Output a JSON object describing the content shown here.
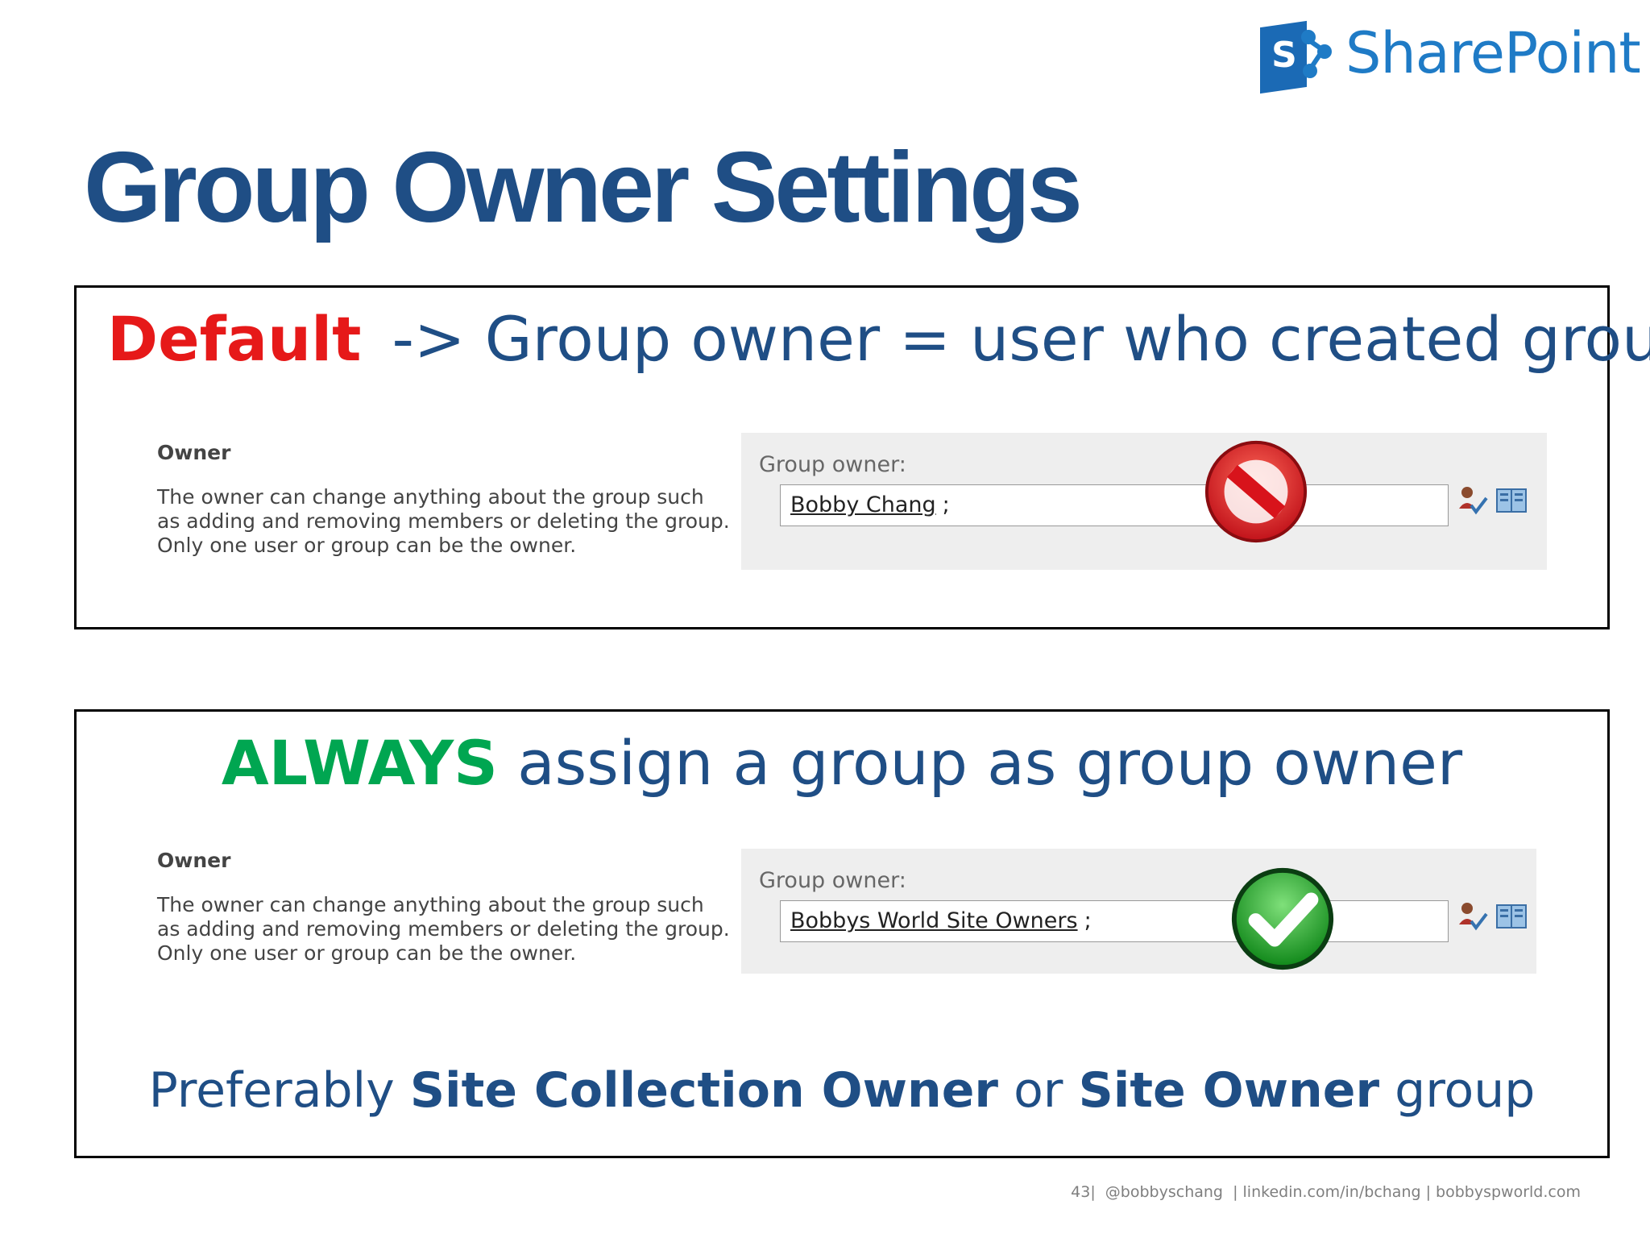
{
  "logo": {
    "mark_letter": "S",
    "text": "SharePoint",
    "color": "#1f7bc6"
  },
  "title": "Group Owner Settings",
  "default_box": {
    "emphasis": "Default",
    "rest": "-> Group owner = user who created group",
    "owner_heading": "Owner",
    "owner_desc": [
      "The owner can change anything about the group such",
      "as adding and removing members or deleting the group.",
      "Only one user or group can be the owner."
    ],
    "field_label": "Group owner:",
    "field_value": "Bobby Chang",
    "field_separator": ";",
    "status_icon": "prohibited-icon"
  },
  "always_box": {
    "emphasis": "ALWAYS",
    "rest": "assign a group as group owner",
    "owner_heading": "Owner",
    "owner_desc": [
      "The owner can change anything about the group such",
      "as adding and removing members or deleting the group.",
      "Only one user or group can be the owner."
    ],
    "field_label": "Group owner:",
    "field_value": "Bobbys World Site Owners",
    "field_separator": ";",
    "status_icon": "checkmark-icon",
    "preferably": {
      "p1": "Preferably",
      "b1": "Site Collection Owner",
      "p2": "or",
      "b2": "Site Owner",
      "p3": "group"
    }
  },
  "footer": {
    "page": "43",
    "twitter": "@bobbyschang",
    "linkedin": "linkedin.com/in/bchang",
    "site": "bobbyspworld.com"
  },
  "colors": {
    "title": "#1f4e85",
    "red": "#e61919",
    "green": "#00a651"
  }
}
